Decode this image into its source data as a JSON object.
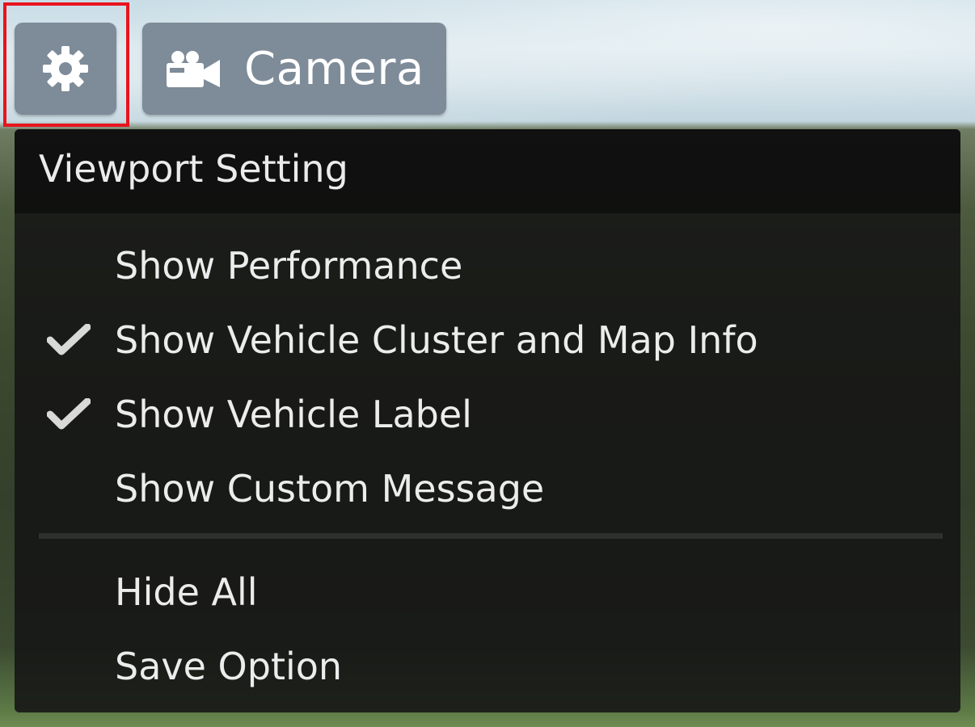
{
  "toolbar": {
    "settings_icon": "gear-icon",
    "camera_icon": "video-camera-icon",
    "camera_label": "Camera"
  },
  "highlight": {
    "color": "#e8141e",
    "target": "settings-button"
  },
  "menu": {
    "title": "Viewport Setting",
    "items": [
      {
        "label": "Show Performance",
        "checked": false
      },
      {
        "label": "Show Vehicle Cluster and Map Info",
        "checked": true
      },
      {
        "label": "Show Vehicle Label",
        "checked": true
      },
      {
        "label": "Show Custom Message",
        "checked": false
      }
    ],
    "actions": [
      {
        "label": "Hide All"
      },
      {
        "label": "Save Option"
      }
    ]
  }
}
